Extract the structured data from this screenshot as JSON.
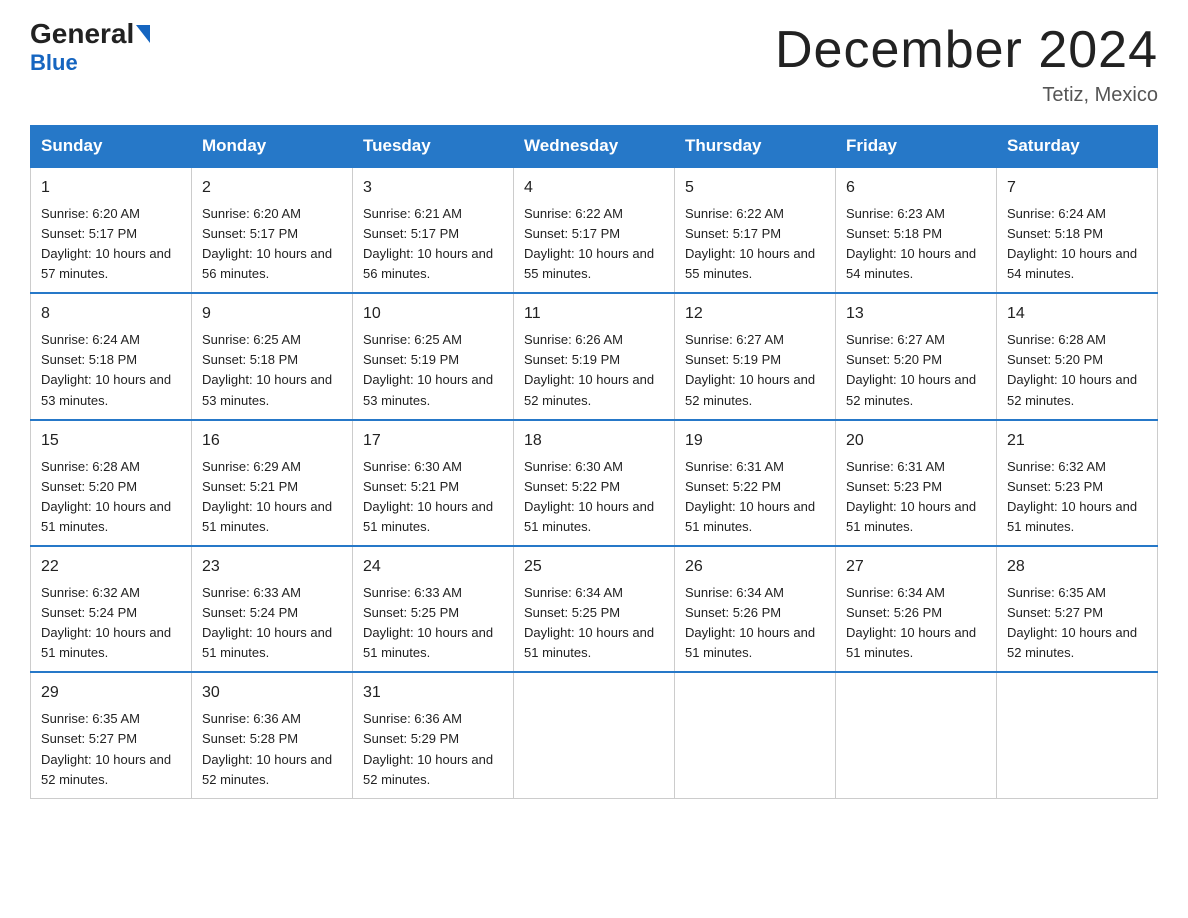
{
  "header": {
    "logo_general": "General",
    "logo_blue": "Blue",
    "month_title": "December 2024",
    "location": "Tetiz, Mexico"
  },
  "days_of_week": [
    "Sunday",
    "Monday",
    "Tuesday",
    "Wednesday",
    "Thursday",
    "Friday",
    "Saturday"
  ],
  "weeks": [
    [
      {
        "day": "1",
        "sunrise": "6:20 AM",
        "sunset": "5:17 PM",
        "daylight": "10 hours and 57 minutes."
      },
      {
        "day": "2",
        "sunrise": "6:20 AM",
        "sunset": "5:17 PM",
        "daylight": "10 hours and 56 minutes."
      },
      {
        "day": "3",
        "sunrise": "6:21 AM",
        "sunset": "5:17 PM",
        "daylight": "10 hours and 56 minutes."
      },
      {
        "day": "4",
        "sunrise": "6:22 AM",
        "sunset": "5:17 PM",
        "daylight": "10 hours and 55 minutes."
      },
      {
        "day": "5",
        "sunrise": "6:22 AM",
        "sunset": "5:17 PM",
        "daylight": "10 hours and 55 minutes."
      },
      {
        "day": "6",
        "sunrise": "6:23 AM",
        "sunset": "5:18 PM",
        "daylight": "10 hours and 54 minutes."
      },
      {
        "day": "7",
        "sunrise": "6:24 AM",
        "sunset": "5:18 PM",
        "daylight": "10 hours and 54 minutes."
      }
    ],
    [
      {
        "day": "8",
        "sunrise": "6:24 AM",
        "sunset": "5:18 PM",
        "daylight": "10 hours and 53 minutes."
      },
      {
        "day": "9",
        "sunrise": "6:25 AM",
        "sunset": "5:18 PM",
        "daylight": "10 hours and 53 minutes."
      },
      {
        "day": "10",
        "sunrise": "6:25 AM",
        "sunset": "5:19 PM",
        "daylight": "10 hours and 53 minutes."
      },
      {
        "day": "11",
        "sunrise": "6:26 AM",
        "sunset": "5:19 PM",
        "daylight": "10 hours and 52 minutes."
      },
      {
        "day": "12",
        "sunrise": "6:27 AM",
        "sunset": "5:19 PM",
        "daylight": "10 hours and 52 minutes."
      },
      {
        "day": "13",
        "sunrise": "6:27 AM",
        "sunset": "5:20 PM",
        "daylight": "10 hours and 52 minutes."
      },
      {
        "day": "14",
        "sunrise": "6:28 AM",
        "sunset": "5:20 PM",
        "daylight": "10 hours and 52 minutes."
      }
    ],
    [
      {
        "day": "15",
        "sunrise": "6:28 AM",
        "sunset": "5:20 PM",
        "daylight": "10 hours and 51 minutes."
      },
      {
        "day": "16",
        "sunrise": "6:29 AM",
        "sunset": "5:21 PM",
        "daylight": "10 hours and 51 minutes."
      },
      {
        "day": "17",
        "sunrise": "6:30 AM",
        "sunset": "5:21 PM",
        "daylight": "10 hours and 51 minutes."
      },
      {
        "day": "18",
        "sunrise": "6:30 AM",
        "sunset": "5:22 PM",
        "daylight": "10 hours and 51 minutes."
      },
      {
        "day": "19",
        "sunrise": "6:31 AM",
        "sunset": "5:22 PM",
        "daylight": "10 hours and 51 minutes."
      },
      {
        "day": "20",
        "sunrise": "6:31 AM",
        "sunset": "5:23 PM",
        "daylight": "10 hours and 51 minutes."
      },
      {
        "day": "21",
        "sunrise": "6:32 AM",
        "sunset": "5:23 PM",
        "daylight": "10 hours and 51 minutes."
      }
    ],
    [
      {
        "day": "22",
        "sunrise": "6:32 AM",
        "sunset": "5:24 PM",
        "daylight": "10 hours and 51 minutes."
      },
      {
        "day": "23",
        "sunrise": "6:33 AM",
        "sunset": "5:24 PM",
        "daylight": "10 hours and 51 minutes."
      },
      {
        "day": "24",
        "sunrise": "6:33 AM",
        "sunset": "5:25 PM",
        "daylight": "10 hours and 51 minutes."
      },
      {
        "day": "25",
        "sunrise": "6:34 AM",
        "sunset": "5:25 PM",
        "daylight": "10 hours and 51 minutes."
      },
      {
        "day": "26",
        "sunrise": "6:34 AM",
        "sunset": "5:26 PM",
        "daylight": "10 hours and 51 minutes."
      },
      {
        "day": "27",
        "sunrise": "6:34 AM",
        "sunset": "5:26 PM",
        "daylight": "10 hours and 51 minutes."
      },
      {
        "day": "28",
        "sunrise": "6:35 AM",
        "sunset": "5:27 PM",
        "daylight": "10 hours and 52 minutes."
      }
    ],
    [
      {
        "day": "29",
        "sunrise": "6:35 AM",
        "sunset": "5:27 PM",
        "daylight": "10 hours and 52 minutes."
      },
      {
        "day": "30",
        "sunrise": "6:36 AM",
        "sunset": "5:28 PM",
        "daylight": "10 hours and 52 minutes."
      },
      {
        "day": "31",
        "sunrise": "6:36 AM",
        "sunset": "5:29 PM",
        "daylight": "10 hours and 52 minutes."
      },
      null,
      null,
      null,
      null
    ]
  ]
}
